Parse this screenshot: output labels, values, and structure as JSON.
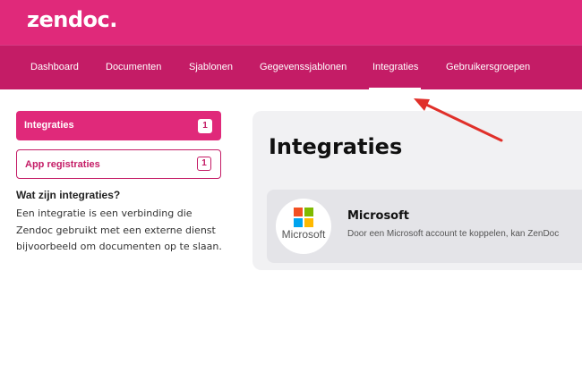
{
  "app": {
    "logo": "zendoc."
  },
  "nav": {
    "items": [
      {
        "label": "Dashboard"
      },
      {
        "label": "Documenten"
      },
      {
        "label": "Sjablonen"
      },
      {
        "label": "Gegevenssjablonen"
      },
      {
        "label": "Integraties"
      },
      {
        "label": "Gebruikersgroepen"
      }
    ],
    "active": "Integraties"
  },
  "sidebar": {
    "items": [
      {
        "label": "Integraties",
        "count": "1"
      },
      {
        "label": "App registraties",
        "count": "1"
      }
    ],
    "info_title": "Wat zijn integraties?",
    "info_text": "Een integratie is een verbinding die Zendoc gebruikt met een externe dienst bijvoorbeeld om documenten op te slaan."
  },
  "main": {
    "title": "Integraties",
    "integrations": [
      {
        "name": "Microsoft",
        "logo_text": "Microsoft",
        "description": "Door een Microsoft account te koppelen, kan ZenDoc"
      }
    ]
  },
  "colors": {
    "brand": "#e0297a",
    "nav": "#c41c66",
    "annotation_arrow": "#e0302a",
    "ms_red": "#f25022",
    "ms_green": "#7fba00",
    "ms_blue": "#00a4ef",
    "ms_yellow": "#ffb900"
  },
  "icons": [
    "microsoft-logo-icon",
    "annotation-arrow-icon"
  ]
}
